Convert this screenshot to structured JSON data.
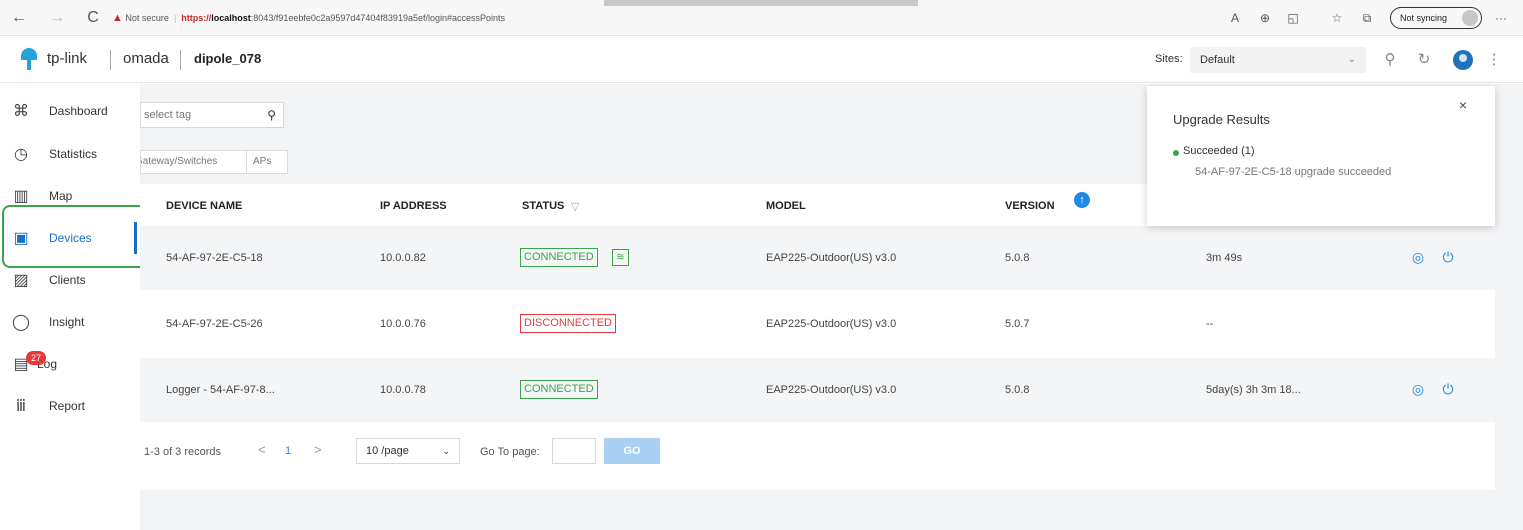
{
  "browser": {
    "back_icon": "←",
    "forward_icon": "→",
    "reload_icon": "C",
    "warning": "▲",
    "not_secure": "Not secure",
    "url_scheme": "https://",
    "url_host": "localhost",
    "url_rest": ":8043/f91eebfe0c2a9597d47404f83919a5ef/login#accessPoints",
    "sync_label": "Not syncing",
    "menu_icon": "···"
  },
  "header": {
    "brand": "tp-link",
    "product": "omada",
    "controller_name": "dipole_078",
    "sites_label": "Sites:",
    "site_value": "Default",
    "brand_color": "#24a4d6",
    "accent_color": "#1a6fc4"
  },
  "sidebar": {
    "items": [
      {
        "label": "Dashboard",
        "icon": "dashboard-icon",
        "glyph": "⌘"
      },
      {
        "label": "Statistics",
        "icon": "statistics-icon",
        "glyph": "◷"
      },
      {
        "label": "Map",
        "icon": "map-icon",
        "glyph": "▥"
      },
      {
        "label": "Devices",
        "icon": "devices-icon",
        "glyph": "▣"
      },
      {
        "label": "Clients",
        "icon": "clients-icon",
        "glyph": "▨"
      },
      {
        "label": "Insight",
        "icon": "insight-icon",
        "glyph": "◯"
      },
      {
        "label": "Log",
        "icon": "log-icon",
        "glyph": "▤"
      },
      {
        "label": "Report",
        "icon": "report-icon",
        "glyph": "ⅲ"
      }
    ],
    "log_badge": "27",
    "active": "Devices"
  },
  "filters": {
    "tag_placeholder": "select tag",
    "type_filter": "Gateway/Switches",
    "ap_filter": "APs"
  },
  "table": {
    "columns": [
      "DEVICE NAME",
      "IP ADDRESS",
      "STATUS",
      "MODEL",
      "VERSION"
    ],
    "status_filter_icon": "▽",
    "version_icon": "↑",
    "rows": [
      {
        "name": "54-AF-97-2E-C5-18",
        "ip": "10.0.0.82",
        "status": "CONNECTED",
        "model": "EAP225-Outdoor(US) v3.0",
        "version": "5.0.8",
        "uptime": "3m 49s"
      },
      {
        "name": "54-AF-97-2E-C5-26",
        "ip": "10.0.0.76",
        "status": "DISCONNECTED",
        "model": "EAP225-Outdoor(US) v3.0",
        "version": "5.0.7",
        "uptime": "--"
      },
      {
        "name": "Logger - 54-AF-97-8...",
        "ip": "10.0.0.78",
        "status": "CONNECTED",
        "model": "EAP225-Outdoor(US) v3.0",
        "version": "5.0.8",
        "uptime": "5day(s) 3h 3m 18..."
      }
    ]
  },
  "pagination": {
    "records": "1-3 of 3 records",
    "prev": "<",
    "current_page": "1",
    "next": ">",
    "page_size": "10 /page",
    "goto_label": "Go To page:",
    "go_button": "GO"
  },
  "popup": {
    "title": "Upgrade Results",
    "close": "×",
    "succeeded": "Succeeded (1)",
    "detail": "54-AF-97-2E-C5-18 upgrade succeeded"
  }
}
